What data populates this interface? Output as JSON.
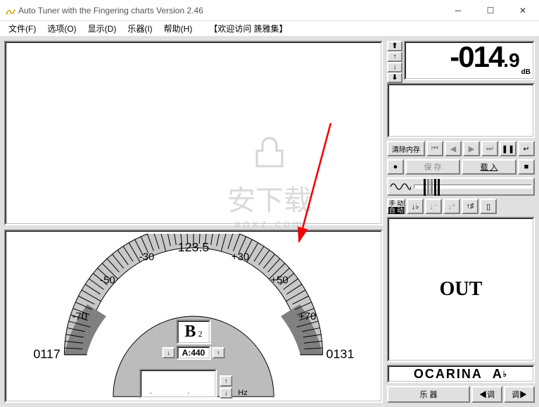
{
  "window": {
    "title": "Auto Tuner with the Fingering charts  Version 2.46"
  },
  "menu": {
    "file": "文件(F)",
    "options": "选项(O)",
    "display": "显示(D)",
    "instrument": "乐器(I)",
    "help": "帮助(H)",
    "visitor": "【欢迎访问 篪雅集】"
  },
  "db": {
    "value": "-014",
    "frac": ".9",
    "unit": "dB"
  },
  "transport": {
    "clear": "清除内存",
    "save": "保 存",
    "load": "载 入"
  },
  "modes": {
    "manual": "手 动",
    "auto": "自 动"
  },
  "output": {
    "out": "OUT"
  },
  "instrument_display": {
    "name": "OCARINA",
    "note": "A",
    "accidental": "♭"
  },
  "bottom": {
    "instrument_btn": "乐  器",
    "tune_prev": "◀调",
    "tune_next": "调▶"
  },
  "gauge": {
    "top_value": "123.5",
    "scale": [
      "-30",
      "+30",
      "-50",
      "+50",
      "-70",
      "+70"
    ],
    "left_num": "0117",
    "right_num": "0131",
    "note": "B",
    "note_octave": "2",
    "pitch_label": "A:440",
    "hz_label": "Hz"
  },
  "watermark": {
    "text": "安下载",
    "sub": "anxz.com"
  }
}
